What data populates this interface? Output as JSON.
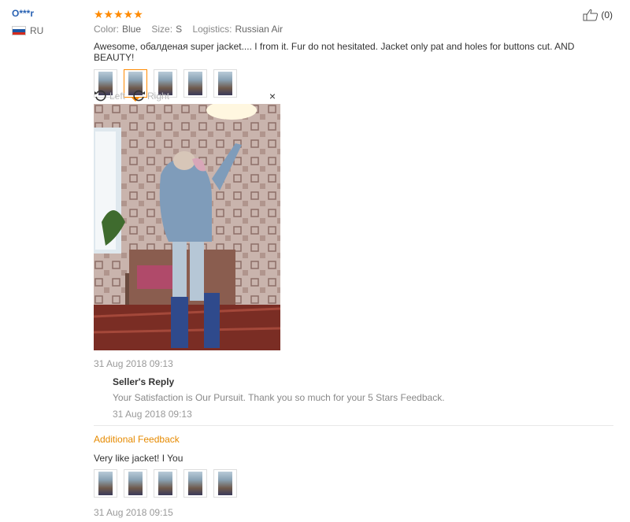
{
  "user": {
    "name": "O***r",
    "country": "RU"
  },
  "review": {
    "stars": "★★★★★",
    "color_label": "Color:",
    "color": "Blue",
    "size_label": "Size:",
    "size": "S",
    "logistics_label": "Logistics:",
    "logistics": "Russian Air",
    "text": "Awesome, обалденая super jacket.... I from it. Fur do not hesitated. Jacket only pat and holes for buttons cut. AND BEAUTY!",
    "like_count": "(0)",
    "thumb_count": 5,
    "active_thumb": 2
  },
  "viewer": {
    "left_label": "Left",
    "right_label": "Right",
    "close": "×"
  },
  "timestamps": {
    "review": "31 Aug 2018 09:13",
    "reply": "31 Aug 2018 09:13",
    "additional": "31 Aug 2018 09:15"
  },
  "reply": {
    "title": "Seller's Reply",
    "text": "Your Satisfaction is Our Pursuit. Thank you so much for your 5 Stars Feedback."
  },
  "additional": {
    "title": "Additional Feedback",
    "text": "Very like jacket! I You"
  },
  "colors": {
    "accent": "#ff8a00",
    "link": "#2962b3",
    "additional_title": "#e68a00"
  }
}
